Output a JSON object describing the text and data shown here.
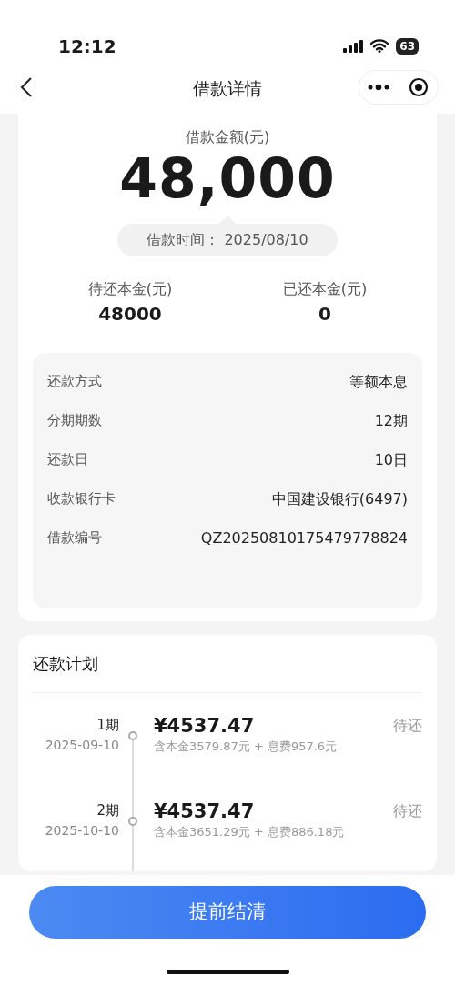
{
  "status_bar": {
    "time": "12:12",
    "battery": "63"
  },
  "nav": {
    "title": "借款详情"
  },
  "summary": {
    "amount_label": "借款金额(元)",
    "amount": "48,000",
    "date_label": "借款时间：",
    "date": "2025/08/10",
    "stats": [
      {
        "label": "待还本金(元)",
        "value": "48000"
      },
      {
        "label": "已还本金(元)",
        "value": "0"
      }
    ]
  },
  "details": [
    {
      "label": "还款方式",
      "value": "等额本息"
    },
    {
      "label": "分期期数",
      "value": "12期"
    },
    {
      "label": "还款日",
      "value": "10日"
    },
    {
      "label": "收款银行卡",
      "value": "中国建设银行(6497)"
    },
    {
      "label": "借款编号",
      "value": "QZ20250810175479778824"
    }
  ],
  "plan": {
    "title": "还款计划",
    "items": [
      {
        "period": "1期",
        "date": "2025-09-10",
        "amount": "¥4537.47",
        "breakdown": "含本金3579.87元 + 息费957.6元",
        "status": "待还"
      },
      {
        "period": "2期",
        "date": "2025-10-10",
        "amount": "¥4537.47",
        "breakdown": "含本金3651.29元 + 息费886.18元",
        "status": "待还"
      }
    ]
  },
  "button": "提前结清"
}
